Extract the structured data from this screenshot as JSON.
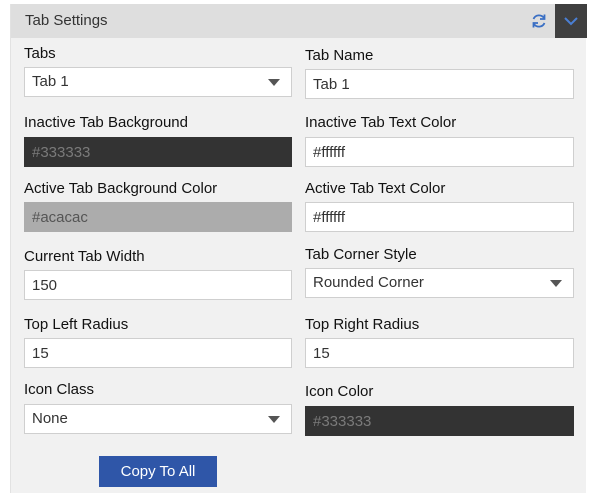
{
  "panel": {
    "title": "Tab Settings"
  },
  "fields": {
    "tabs": {
      "label": "Tabs",
      "value": "Tab 1"
    },
    "tab_name": {
      "label": "Tab Name",
      "value": "Tab 1"
    },
    "inactive_bg": {
      "label": "Inactive Tab Background",
      "value": "#333333"
    },
    "inactive_text_color": {
      "label": "Inactive Tab Text Color",
      "value": "#ffffff"
    },
    "active_bg": {
      "label": "Active Tab Background Color",
      "value": "#acacac"
    },
    "active_text_color": {
      "label": "Active Tab Text Color",
      "value": "#ffffff"
    },
    "current_tab_width": {
      "label": "Current Tab Width",
      "value": "150"
    },
    "tab_corner_style": {
      "label": "Tab Corner Style",
      "value": "Rounded Corner"
    },
    "top_left_radius": {
      "label": "Top Left Radius",
      "value": "15"
    },
    "top_right_radius": {
      "label": "Top Right Radius",
      "value": "15"
    },
    "icon_class": {
      "label": "Icon Class",
      "value": "None"
    },
    "icon_color": {
      "label": "Icon Color",
      "value": "#333333"
    }
  },
  "actions": {
    "copy_to_all": "Copy To All"
  },
  "icons": {
    "refresh": "refresh-icon",
    "collapse": "chevron-down-icon"
  },
  "colors": {
    "accent": "#2f56a8",
    "header_bg": "#dedede",
    "panel_bg": "#f1f1f1",
    "collapse_bg": "#3f3f3f"
  }
}
